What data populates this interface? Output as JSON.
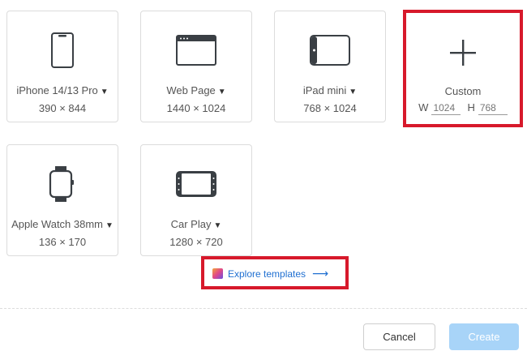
{
  "presets": [
    {
      "label": "iPhone 14/13 Pro",
      "dims": "390 × 844",
      "icon": "phone-icon"
    },
    {
      "label": "Web Page",
      "dims": "1440 × 1024",
      "icon": "browser-window-icon"
    },
    {
      "label": "iPad mini",
      "dims": "768 × 1024",
      "icon": "tablet-icon"
    },
    {
      "label": "Apple Watch 38mm",
      "dims": "136 × 170",
      "icon": "watch-icon"
    },
    {
      "label": "Car Play",
      "dims": "1280 × 720",
      "icon": "car-screen-icon"
    }
  ],
  "custom": {
    "label": "Custom",
    "icon": "plus-icon",
    "width_label": "W",
    "width_placeholder": "1024",
    "height_label": "H",
    "height_placeholder": "768"
  },
  "explore": {
    "label": "Explore templates",
    "icon": "templates-icon"
  },
  "footer": {
    "cancel_label": "Cancel",
    "create_label": "Create"
  },
  "colors": {
    "highlight": "#d7192b",
    "link": "#1f6fd1",
    "create_disabled": "#a8d4f8"
  }
}
